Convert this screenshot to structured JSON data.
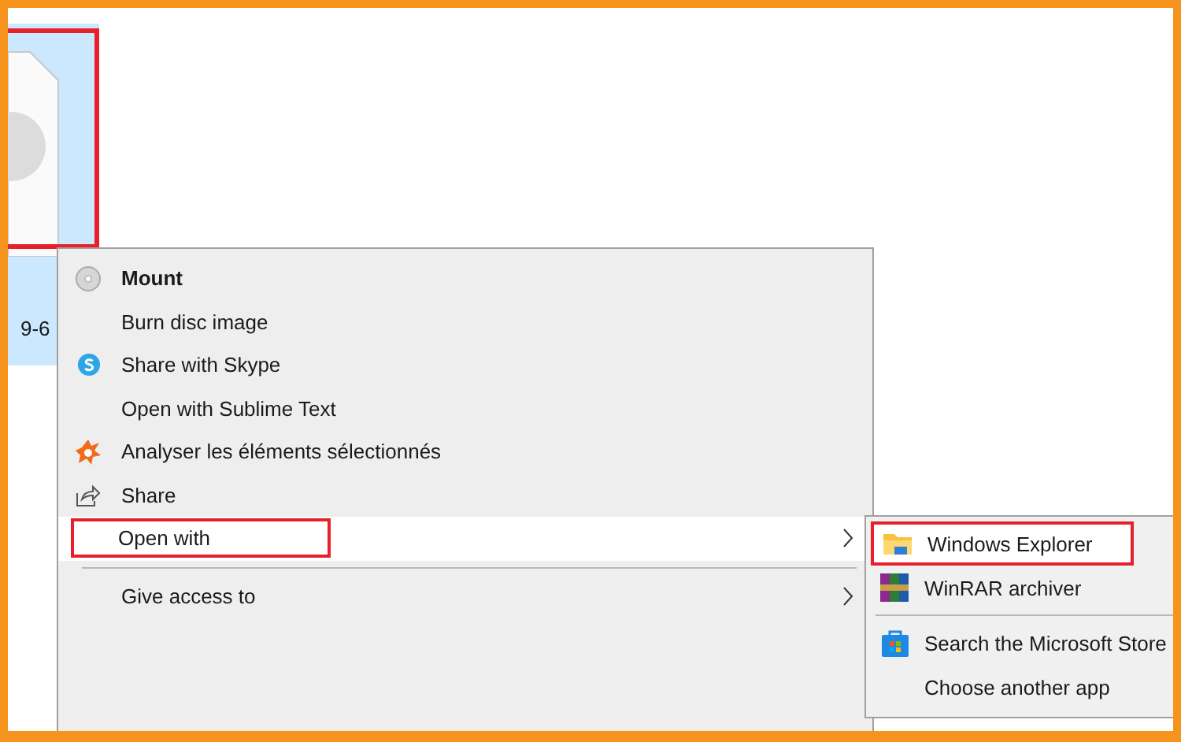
{
  "file": {
    "label": "9-6",
    "selected": true,
    "annotated": true
  },
  "context_menu": {
    "items": [
      {
        "label": "Mount",
        "kind": "disc",
        "bold": true,
        "selected": false,
        "submenu": false,
        "annotated": false
      },
      {
        "label": "Burn disc image",
        "kind": "plain",
        "bold": false,
        "selected": false,
        "submenu": false,
        "annotated": false
      },
      {
        "label": "Share with Skype",
        "kind": "skype",
        "bold": false,
        "selected": false,
        "submenu": false,
        "annotated": false
      },
      {
        "label": "Open with Sublime Text",
        "kind": "plain",
        "bold": false,
        "selected": false,
        "submenu": false,
        "annotated": false
      },
      {
        "label": "Analyser les éléments sélectionnés",
        "kind": "avast",
        "bold": false,
        "selected": false,
        "submenu": false,
        "annotated": false
      },
      {
        "label": "Share",
        "kind": "share",
        "bold": false,
        "selected": false,
        "submenu": false,
        "annotated": false
      },
      {
        "label": "Open with",
        "kind": "plain",
        "bold": false,
        "selected": true,
        "submenu": true,
        "annotated": true
      },
      {
        "kind": "separator"
      },
      {
        "label": "Give access to",
        "kind": "plain",
        "bold": false,
        "selected": false,
        "submenu": true,
        "annotated": false
      }
    ]
  },
  "submenu": {
    "items": [
      {
        "label": "Windows Explorer",
        "kind": "folder",
        "annotated": true
      },
      {
        "label": "WinRAR archiver",
        "kind": "winrar",
        "annotated": false
      },
      {
        "kind": "separator"
      },
      {
        "label": "Search the Microsoft Store",
        "kind": "store",
        "annotated": false
      },
      {
        "label": "Choose another app",
        "kind": "plain",
        "annotated": false
      }
    ]
  }
}
